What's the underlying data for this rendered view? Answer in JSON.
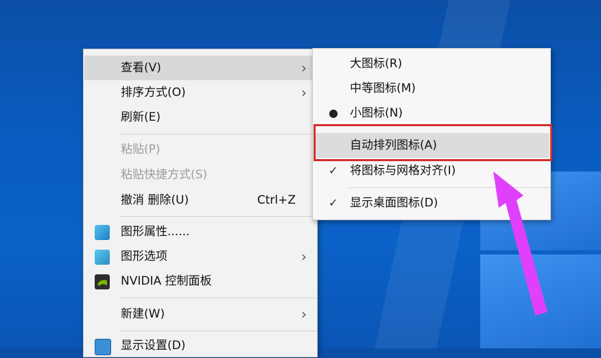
{
  "context_menu": {
    "items": [
      {
        "label": "查看(V)"
      },
      {
        "label": "排序方式(O)"
      },
      {
        "label": "刷新(E)"
      },
      {
        "label": "粘贴(P)"
      },
      {
        "label": "粘贴快捷方式(S)"
      },
      {
        "label": "撤消 删除(U)",
        "shortcut": "Ctrl+Z"
      },
      {
        "label": "图形属性......"
      },
      {
        "label": "图形选项"
      },
      {
        "label": "NVIDIA 控制面板"
      },
      {
        "label": "新建(W)"
      },
      {
        "label": "显示设置(D)"
      }
    ]
  },
  "view_submenu": {
    "items": [
      {
        "label": "大图标(R)"
      },
      {
        "label": "中等图标(M)"
      },
      {
        "label": "小图标(N)",
        "mark": "●"
      },
      {
        "label": "自动排列图标(A)"
      },
      {
        "label": "将图标与网格对齐(I)",
        "mark": "✓"
      },
      {
        "label": "显示桌面图标(D)",
        "mark": "✓"
      }
    ]
  },
  "annotation": {
    "highlight_color": "#d62d2d",
    "arrow_color": "#e040fb"
  },
  "icons": {
    "arrow": "›"
  }
}
